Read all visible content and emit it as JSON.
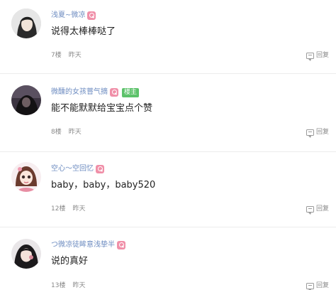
{
  "comments": [
    {
      "username": "浅夏~微凉",
      "content": "说得太棒棒哒了",
      "floor": "7楼",
      "time": "昨天",
      "reply_label": "回复",
      "is_op": false
    },
    {
      "username": "微醺的女孩嘗气摘",
      "op_label": "楼主",
      "content": "能不能默默给宝宝点个赞",
      "floor": "8楼",
      "time": "昨天",
      "reply_label": "回复",
      "is_op": true
    },
    {
      "username": "空心～空回忆",
      "content": "baby，baby，baby520",
      "floor": "12楼",
      "time": "昨天",
      "reply_label": "回复",
      "is_op": false
    },
    {
      "username": "つ微凉徒眸意浅挚半",
      "content": "说的真好",
      "floor": "13楼",
      "time": "昨天",
      "reply_label": "回复",
      "is_op": false
    }
  ],
  "icons": {
    "vip_badge": "vip-badge-icon",
    "reply": "reply-icon"
  },
  "colors": {
    "username": "#6c8bc0",
    "badge": "#f08fa8",
    "op_badge": "#5cc26a",
    "meta": "#888888",
    "divider": "#ececec"
  }
}
